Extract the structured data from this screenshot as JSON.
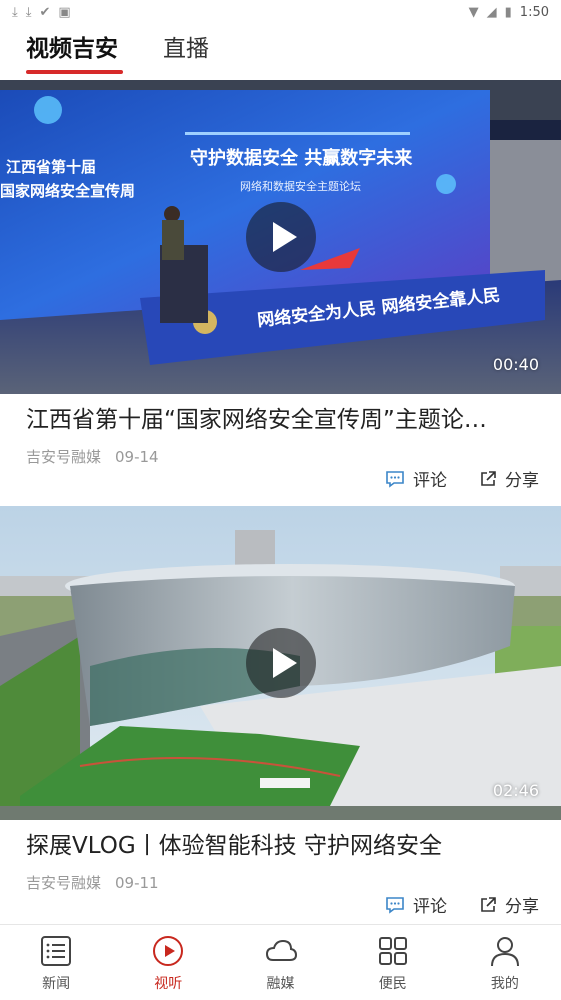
{
  "status_bar": {
    "time": "1:50"
  },
  "tabs": [
    {
      "label": "视频吉安",
      "active": true
    },
    {
      "label": "直播",
      "active": false
    }
  ],
  "videos": [
    {
      "title": "江西省第十届“国家网络安全宣传周”主题论…",
      "source": "吉安号融媒",
      "date": "09-14",
      "duration": "00:40",
      "thumb_texts": [
        "江西省第十届",
        "国家网络安全宣传周",
        "守护数据安全  共赢数字未来",
        "网络和数据安全主题论坛",
        "网络安全为人民   网络安全靠人民"
      ],
      "comment_label": "评论",
      "share_label": "分享"
    },
    {
      "title": "探展VLOG丨体验智能科技 守护网络安全",
      "source": "吉安号融媒",
      "date": "09-11",
      "duration": "02:46",
      "comment_label": "评论",
      "share_label": "分享"
    }
  ],
  "bottom_nav": [
    {
      "label": "新闻",
      "icon": "news-list-icon",
      "active": false
    },
    {
      "label": "视听",
      "icon": "play-circle-icon",
      "active": true
    },
    {
      "label": "融媒",
      "icon": "cloud-icon",
      "active": false
    },
    {
      "label": "便民",
      "icon": "grid-icon",
      "active": false
    },
    {
      "label": "我的",
      "icon": "person-icon",
      "active": false
    }
  ],
  "colors": {
    "accent": "#d72a2a"
  }
}
